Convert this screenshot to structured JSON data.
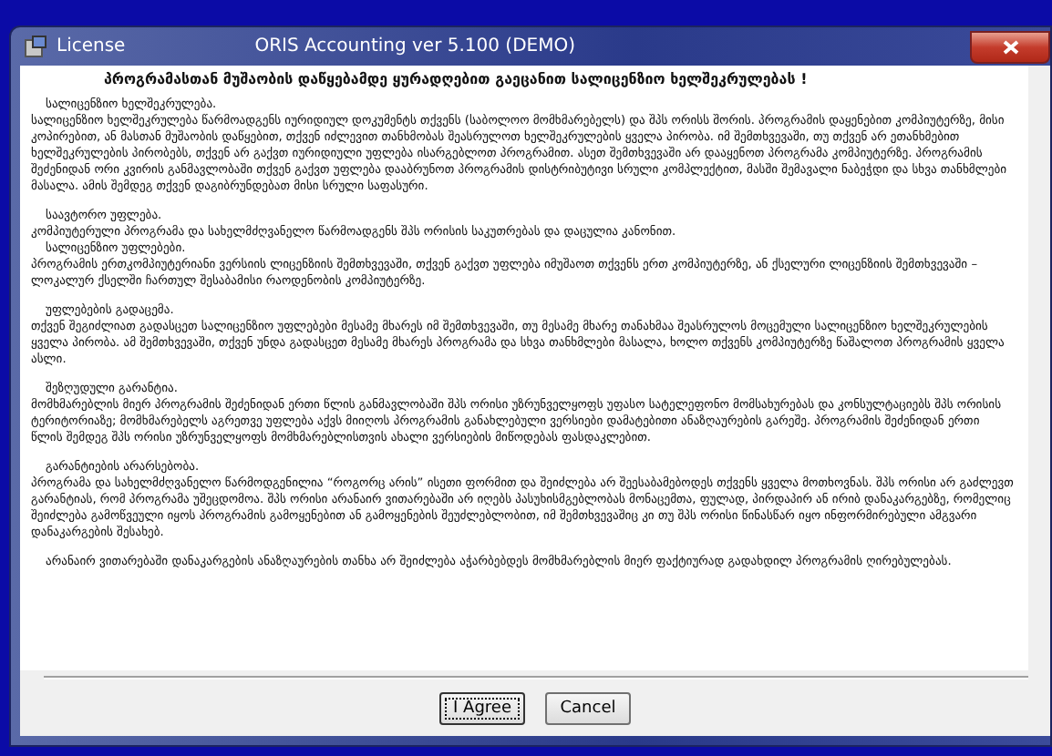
{
  "window": {
    "title": "License",
    "caption": "ORIS Accounting ver 5.100 (DEMO)"
  },
  "heading": "პროგრამასთან მუშაობის დაწყებამდე ყურადღებით გაეცანით სალიცენზიო ხელშეკრულებას !",
  "sections": [
    {
      "blocks": [
        {
          "kind": "title",
          "text": "სალიცენზიო ხელშეკრულება."
        },
        {
          "kind": "body",
          "text": "სალიცენზიო ხელშეკრულება წარმოადგენს იურიდიულ დოკუმენტს თქვენს (საბოლოო მომხმარებელს) და შპს ორისს შორის. პროგრამის დაყენებით კომპიუტერზე, მისი კოპირებით, ან მასთან მუშაობის დაწყებით, თქვენ იძლევით თანხმობას შეასრულოთ ხელშეკრულების ყველა პირობა.  იმ შემთხვევაში, თუ თქვენ არ ეთანხმებით ხელშეკრულების პირობებს, თქვენ არ გაქვთ იურიდიული უფლება ისარგებლოთ პროგრამით. ასეთ შემთხვევაში არ დააყენოთ პროგრამა კომპიუტერზე. პროგრამის შეძენიდან ორი კვირის განმავლობაში თქვენ გაქვთ უფლება დააბრუნოთ პროგრამის დისტრიბუტივი სრული კომპლექტით, მასში შემავალი ნაბეჭდი და სხვა თანხმლები მასალა. ამის შემდეგ თქვენ დაგიბრუნდებათ მისი სრული საფასური."
        }
      ]
    },
    {
      "blocks": [
        {
          "kind": "title",
          "text": "საავტორო უფლება."
        },
        {
          "kind": "body",
          "text": "კომპიუტერული პროგრამა და სახელმძღვანელო წარმოადგენს შპს ორისის საკუთრებას და დაცულია კანონით."
        },
        {
          "kind": "title",
          "text": "სალიცენზიო უფლებები."
        },
        {
          "kind": "body",
          "text": "პროგრამის ერთკომპიუტერიანი ვერსიის ლიცენზიის შემთხვევაში, თქვენ გაქვთ უფლება იმუშაოთ თქვენს ერთ კომპიუტერზე, ან ქსელური ლიცენზიის შემთხვევაში – ლოკალურ ქსელში ჩართულ შესაბამისი რაოდენობის კომპიუტერზე."
        }
      ]
    },
    {
      "blocks": [
        {
          "kind": "title",
          "text": "უფლებების გადაცემა."
        },
        {
          "kind": "body",
          "text": "თქვენ შეგიძლიათ გადასცეთ სალიცენზიო უფლებები   მესამე მხარეს იმ შემთხვევაში, თუ მესამე მხარე თანახმაა შეასრულოს მოცემული სალიცენზიო ხელშეკრულების ყველა პირობა. ამ შემთხვევაში, თქვენ უნდა გადასცეთ მესამე მხარეს პროგრამა და სხვა თანხმლები მასალა, ხოლო თქვენს კომპიუტერზე წაშალოთ პროგრამის ყველა ასლი."
        }
      ]
    },
    {
      "blocks": [
        {
          "kind": "title",
          "text": "შეზღუდული გარანტია."
        },
        {
          "kind": "body",
          "text": "მომხმარებლის მიერ პროგრამის შეძენიდან  ერთი წლის განმავლობაში შპს ორისი უზრუნველყოფს უფასო სატელეფონო მომსახურებას და კონსულტაციებს შპს ორისის ტერიტორიაზე; მომხმარებელს აგრეთვე უფლება აქვს მიიღოს პროგრამის განახლებული ვერსიები დამატებითი ანაზღაურების გარეშე. პროგრამის შეძენიდან ერთი წლის    შემდეგ შპს ორისი უზრუნველყოფს მომხმარებლისთვის ახალი ვერსიების მიწოდებას ფასდაკლებით."
        }
      ]
    },
    {
      "blocks": [
        {
          "kind": "title",
          "text": "გარანტიების არარსებობა."
        },
        {
          "kind": "body",
          "text": "პროგრამა და სახელმძღვანელო წარმოდგენილია “როგორც არის” ისეთი ფორმით და შეიძლება არ შეესაბამებოდეს თქვენს ყველა მოთხოვნას. შპს ორისი არ გაძლევთ გარანტიას, რომ პროგრამა უშეცდომოა. შპს ორისი არანაირ ვითარებაში არ იღებს პასუხისმგებლობას მონაცემთა, ფულად, პირდაპირ ან ირიბ დანაკარგებზე, რომელიც შეიძლება გამოწვეული იყოს პროგრამის გამოყენებით ან გამოყენების შეუძლებლობით, იმ შემთხვევაშიც კი თუ შპს ორისი წინასწარ იყო ინფორმირებული  ამგვარი დანაკარგების შესახებ."
        }
      ]
    },
    {
      "blocks": [
        {
          "kind": "lead",
          "text": "არანაირ ვითარებაში დანაკარგების ანაზღაურების თანხა არ შეიძლება აჭარბებდეს მომხმარებლის მიერ ფაქტიურად გადახდილ პროგრამის ღირებულებას."
        }
      ]
    }
  ],
  "buttons": [
    {
      "label": "I Agree",
      "focused": true
    },
    {
      "label": "Cancel",
      "focused": false
    }
  ]
}
